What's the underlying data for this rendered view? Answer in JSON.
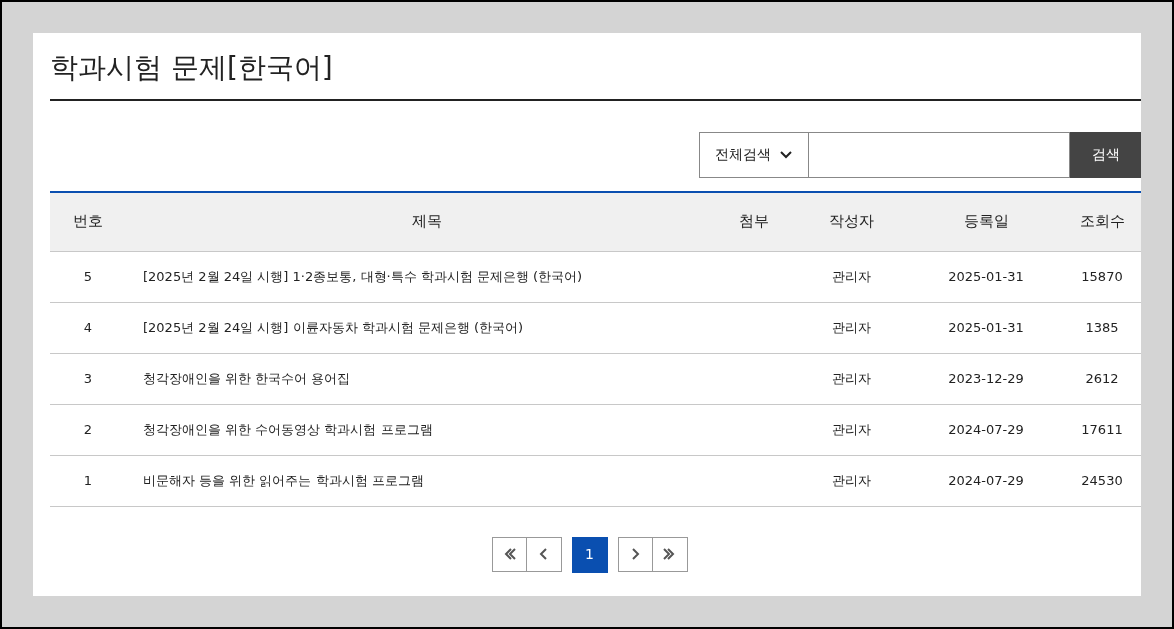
{
  "page_title": "학과시험 문제[한국어]",
  "search": {
    "scope": "전체검색",
    "button": "검색"
  },
  "table": {
    "columns": [
      "번호",
      "제목",
      "첨부",
      "작성자",
      "등록일",
      "조회수"
    ],
    "rows": [
      {
        "no": "5",
        "title": "[2025년 2월 24일 시행] 1·2종보통, 대형·특수 학과시험 문제은행 (한국어)",
        "author": "관리자",
        "date": "2025-01-31",
        "views": "15870"
      },
      {
        "no": "4",
        "title": "[2025년 2월 24일 시행] 이륜자동차 학과시험 문제은행 (한국어)",
        "author": "관리자",
        "date": "2025-01-31",
        "views": "1385"
      },
      {
        "no": "3",
        "title": "청각장애인을 위한 한국수어 용어집",
        "author": "관리자",
        "date": "2023-12-29",
        "views": "2612"
      },
      {
        "no": "2",
        "title": "청각장애인을 위한 수어동영상 학과시험 프로그램",
        "author": "관리자",
        "date": "2024-07-29",
        "views": "17611"
      },
      {
        "no": "1",
        "title": "비문해자 등을 위한 읽어주는 학과시험 프로그램",
        "author": "관리자",
        "date": "2024-07-29",
        "views": "24530"
      }
    ]
  },
  "pagination": {
    "pages": [
      {
        "label": "1",
        "selected": true
      }
    ]
  }
}
